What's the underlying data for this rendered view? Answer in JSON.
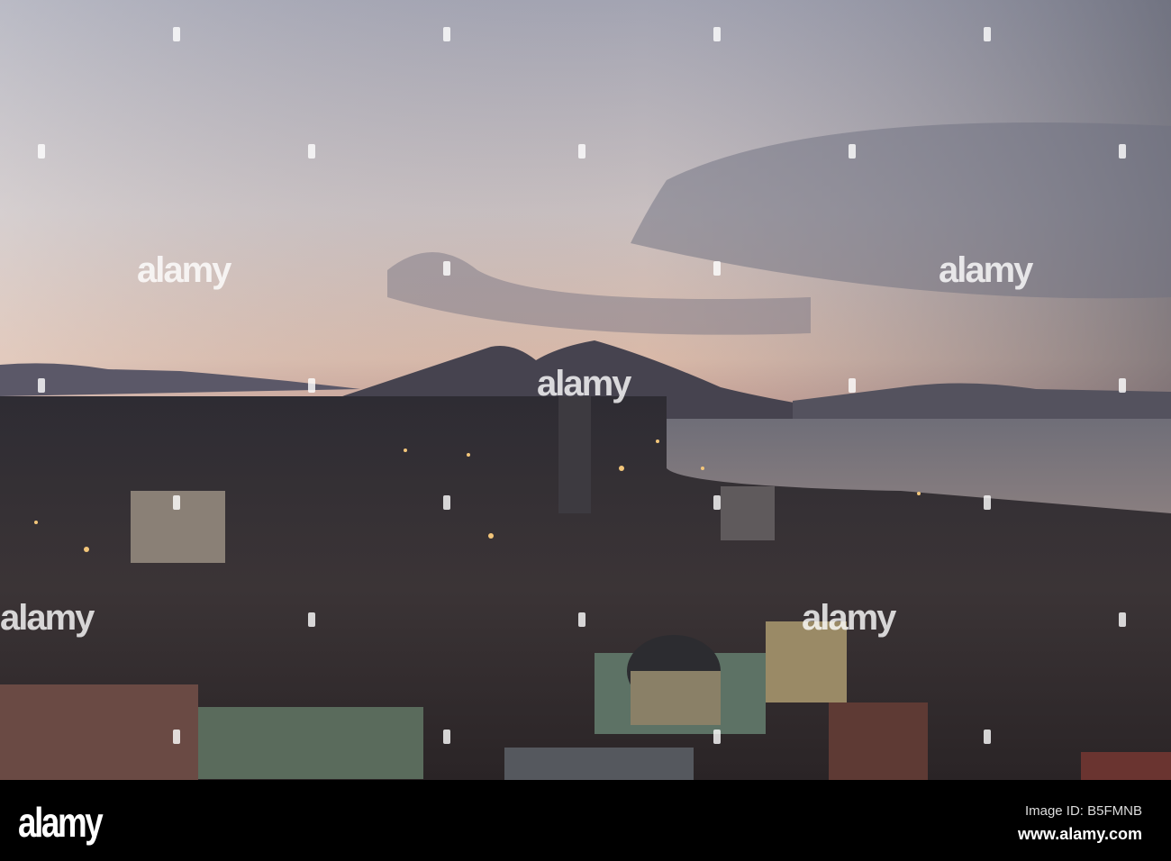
{
  "watermark": {
    "brand": "alamy"
  },
  "footer": {
    "logo": "alamy",
    "image_id": "Image ID: B5FMNB",
    "url": "www.alamy.com"
  }
}
